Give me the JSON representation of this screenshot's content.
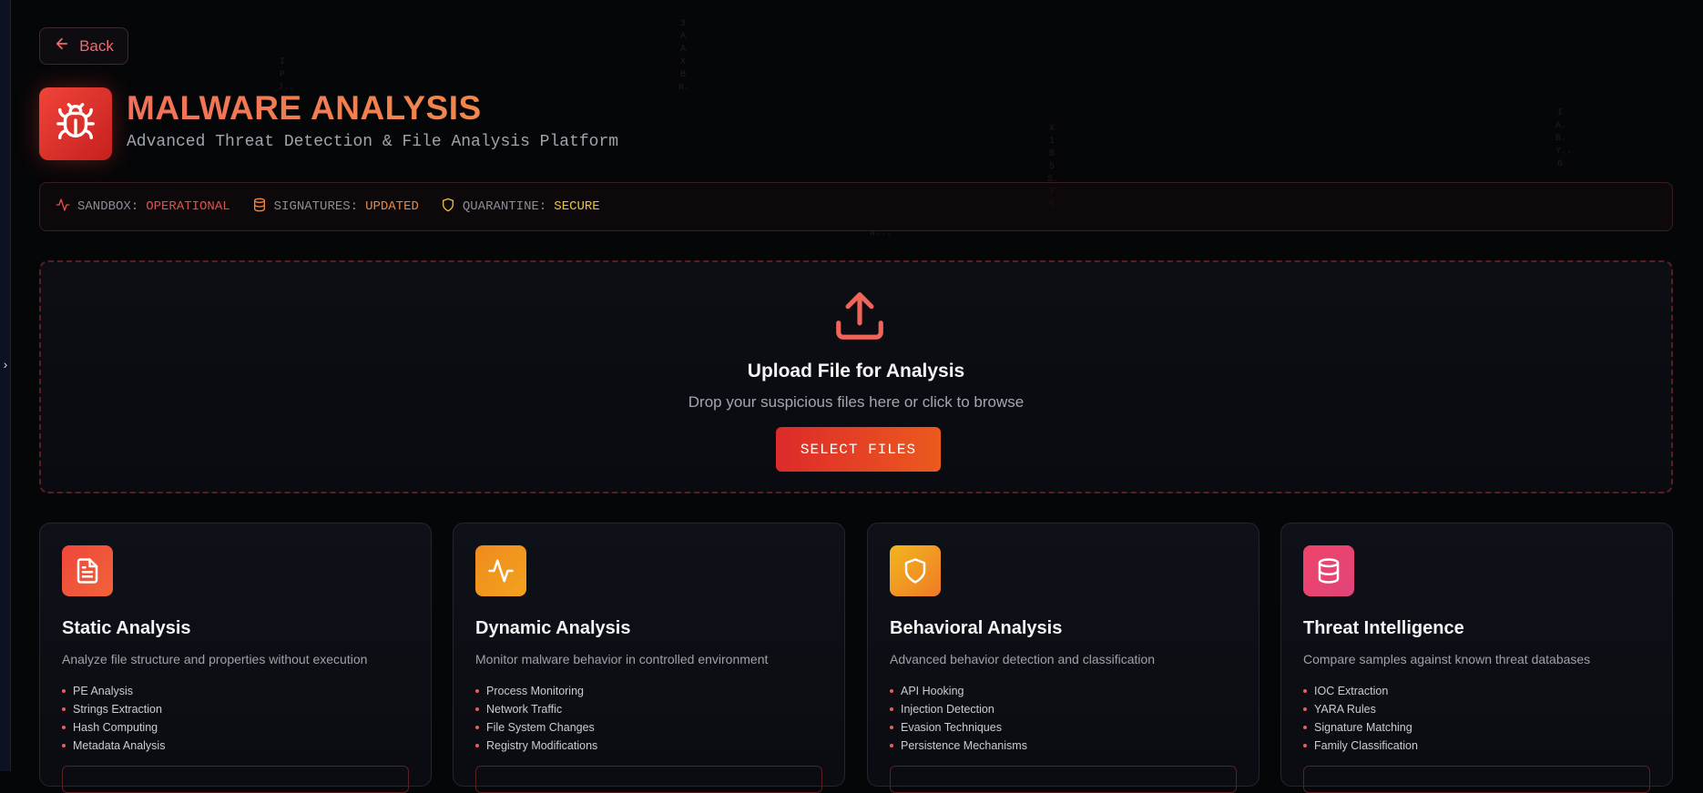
{
  "nav": {
    "back_label": "Back"
  },
  "header": {
    "title": "MALWARE ANALYSIS",
    "subtitle": "Advanced Threat Detection & File Analysis Platform"
  },
  "status": [
    {
      "label": "SANDBOX:",
      "value": "OPERATIONAL",
      "color": "#e0524c",
      "icon": "activity-icon"
    },
    {
      "label": "SIGNATURES:",
      "value": "UPDATED",
      "color": "#ee8740",
      "icon": "database-icon"
    },
    {
      "label": "QUARANTINE:",
      "value": "SECURE",
      "color": "#f2c233",
      "icon": "shield-icon"
    }
  ],
  "upload": {
    "title": "Upload File for Analysis",
    "description": "Drop your suspicious files here or click to browse",
    "button_label": "SELECT FILES"
  },
  "cards": [
    {
      "title": "Static Analysis",
      "description": "Analyze file structure and properties without execution",
      "features": [
        "PE Analysis",
        "Strings Extraction",
        "Hash Computing",
        "Metadata Analysis"
      ],
      "icon": "file-text-icon",
      "gradient": [
        "#f0473a",
        "#f0633a"
      ]
    },
    {
      "title": "Dynamic Analysis",
      "description": "Monitor malware behavior in controlled environment",
      "features": [
        "Process Monitoring",
        "Network Traffic",
        "File System Changes",
        "Registry Modifications"
      ],
      "icon": "activity-icon",
      "gradient": [
        "#f08a1e",
        "#f2a21e"
      ]
    },
    {
      "title": "Behavioral Analysis",
      "description": "Advanced behavior detection and classification",
      "features": [
        "API Hooking",
        "Injection Detection",
        "Evasion Techniques",
        "Persistence Mechanisms"
      ],
      "icon": "shield-icon",
      "gradient": [
        "#f2b61e",
        "#f07a26"
      ]
    },
    {
      "title": "Threat Intelligence",
      "description": "Compare samples against known threat databases",
      "features": [
        "IOC Extraction",
        "YARA Rules",
        "Signature Matching",
        "Family Classification"
      ],
      "icon": "database-icon",
      "gradient": [
        "#f0436a",
        "#e0457a"
      ]
    }
  ],
  "background_matrix": [
    "IP J..",
    "3AAXB N.",
    "N...",
    "X1B5S.Y0",
    "IA.B.Y..6"
  ]
}
